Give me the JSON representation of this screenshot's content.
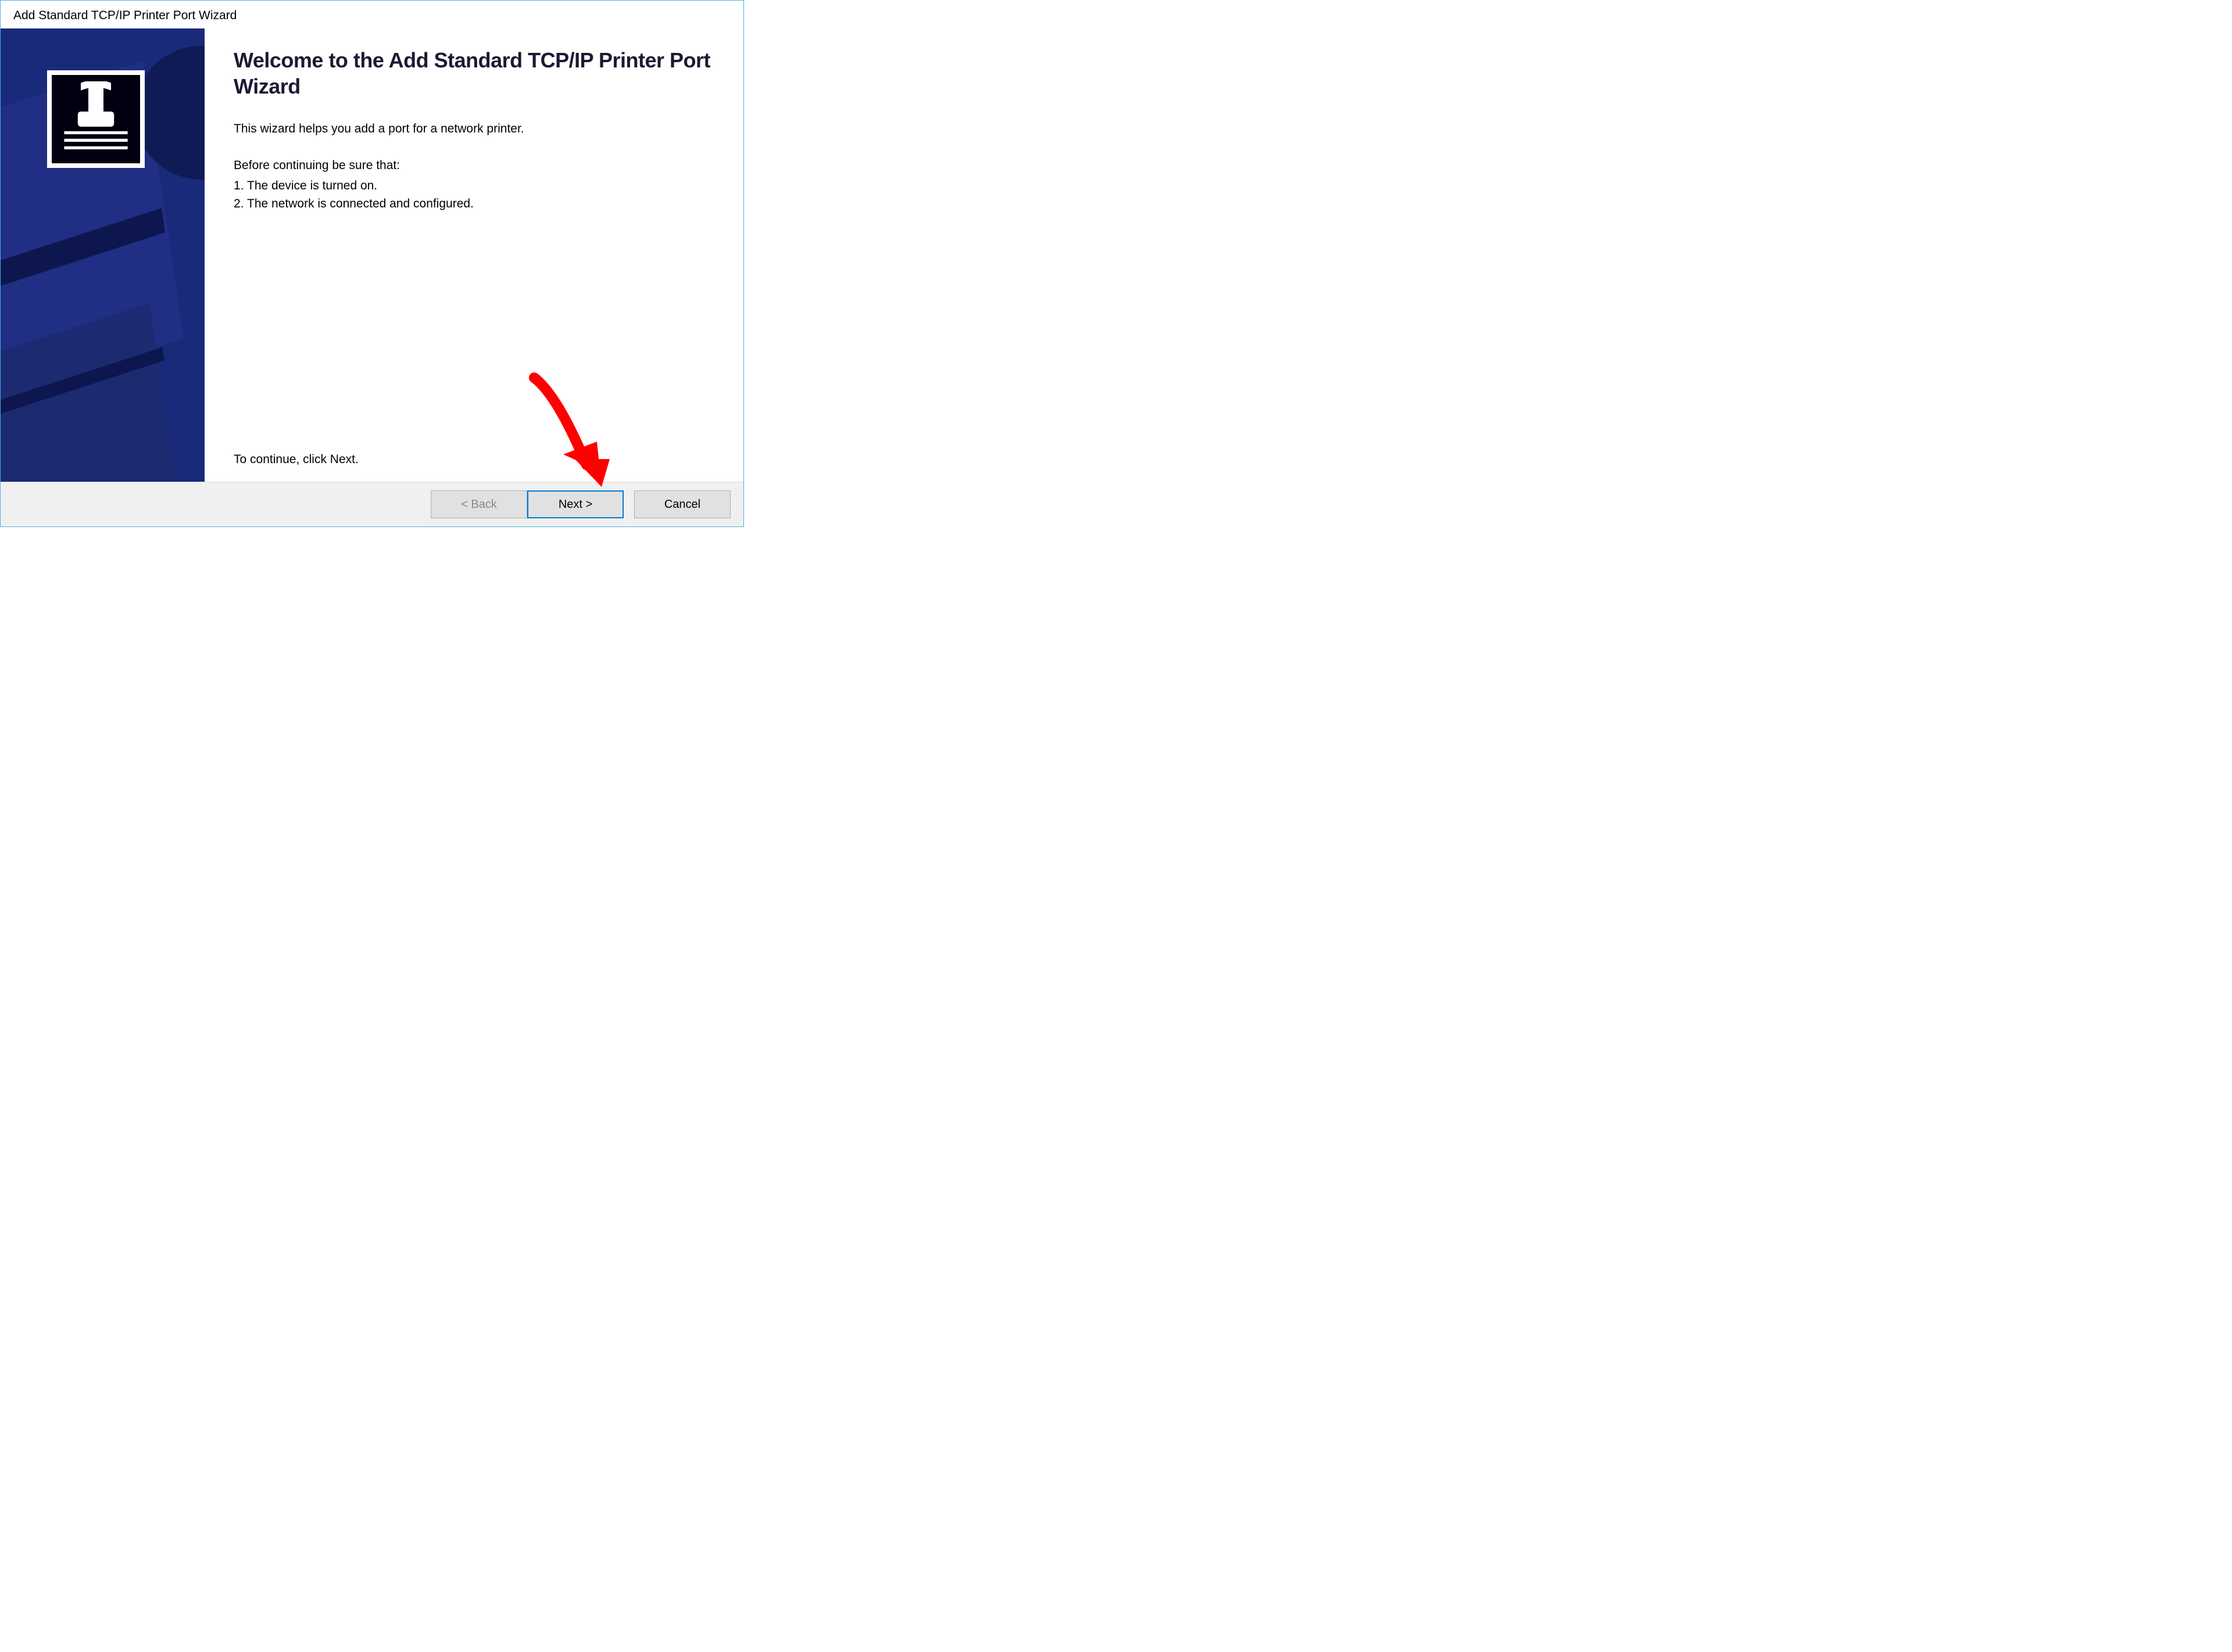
{
  "window": {
    "title": "Add Standard TCP/IP Printer Port Wizard"
  },
  "content": {
    "heading": "Welcome to the Add Standard TCP/IP Printer Port Wizard",
    "intro": "This wizard helps you add a port for a network printer.",
    "before_label": "Before continuing be sure that:",
    "item1": "1.  The device is turned on.",
    "item2": "2.  The network is connected and configured.",
    "continue_text": "To continue, click Next."
  },
  "buttons": {
    "back": "< Back",
    "next": "Next >",
    "cancel": "Cancel"
  },
  "icons": {
    "sidebar_icon": "printer-stamp-icon"
  }
}
